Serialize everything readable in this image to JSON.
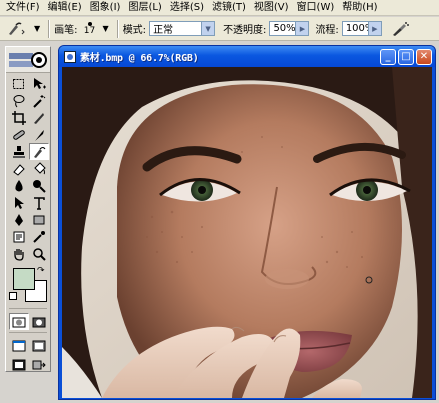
{
  "menubar": {
    "items": [
      "文件(F)",
      "编辑(E)",
      "图象(I)",
      "图层(L)",
      "选择(S)",
      "滤镜(T)",
      "视图(V)",
      "窗口(W)",
      "帮助(H)"
    ]
  },
  "options": {
    "brush_label": "画笔:",
    "brush_size": "17",
    "mode_label": "模式:",
    "mode_value": "正常",
    "opacity_label": "不透明度:",
    "opacity_value": "50%",
    "flow_label": "流程:",
    "flow_value": "100%"
  },
  "document": {
    "title": "素材.bmp @ 66.7%(RGB)"
  },
  "colors": {
    "foreground": "#c5dbc5",
    "background": "#ffffff",
    "titlebar": "#0a57e0"
  },
  "icons": {
    "active_tool": "healing-brush-icon"
  }
}
